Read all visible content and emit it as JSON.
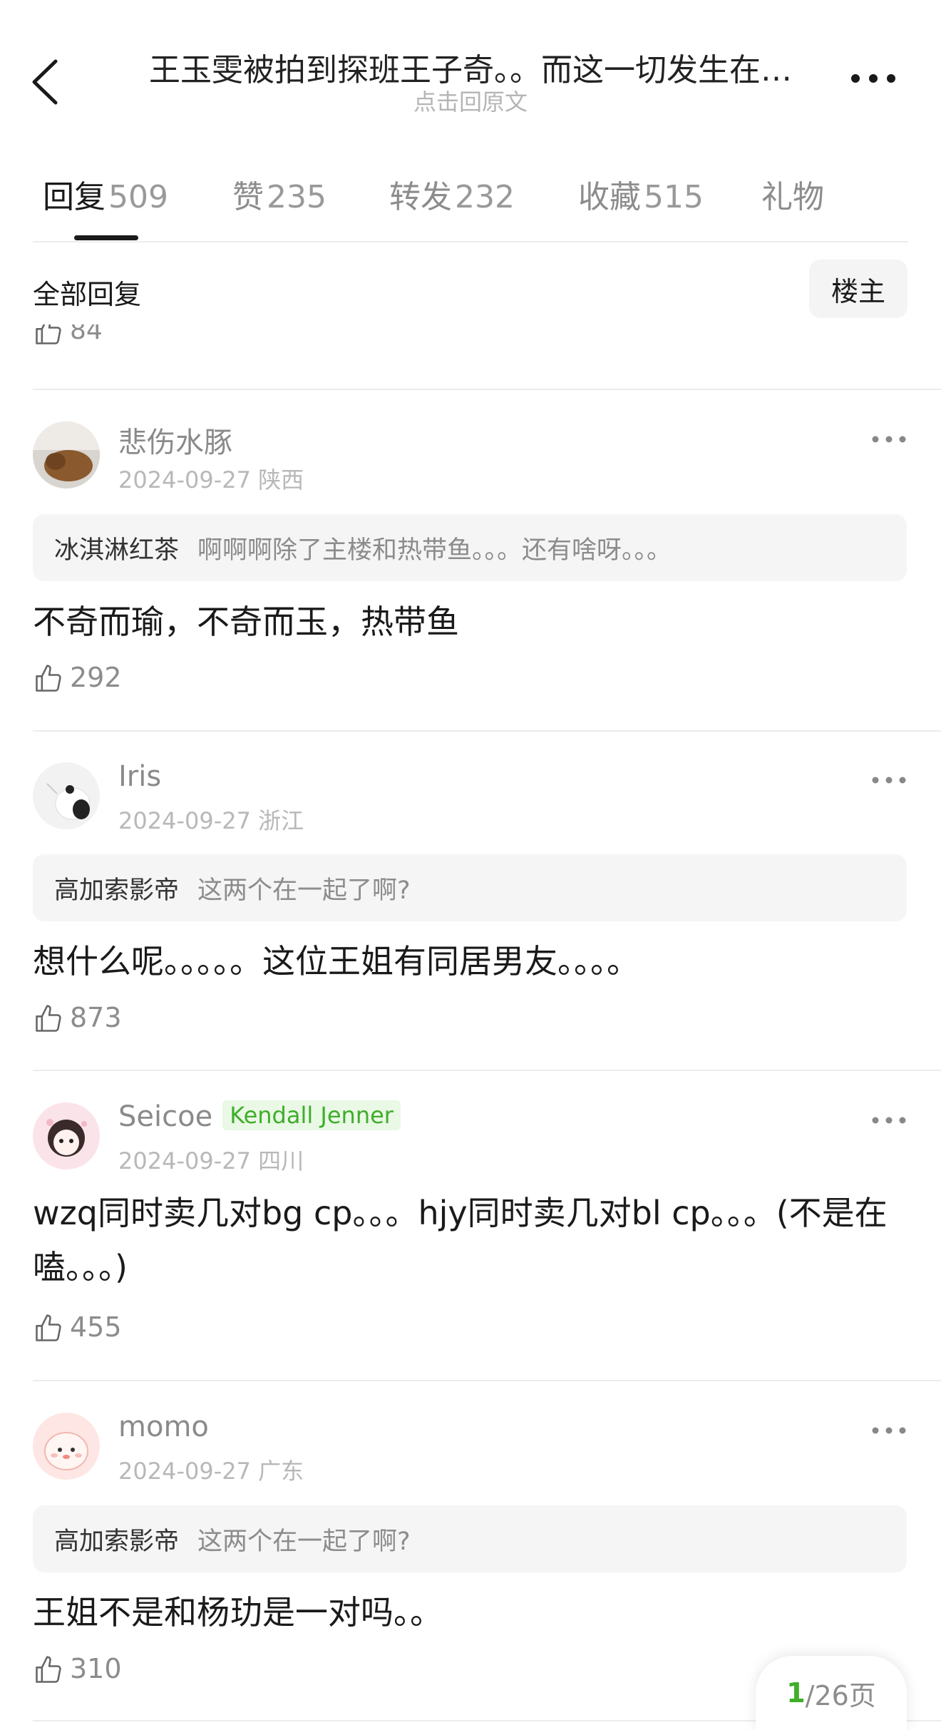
{
  "header": {
    "title": "王玉雯被拍到探班王子奇。。而这一切发生在…",
    "subtitle": "点击回原文"
  },
  "tabs": [
    {
      "label": "回复",
      "count": "509"
    },
    {
      "label": "赞",
      "count": "235"
    },
    {
      "label": "转发",
      "count": "232"
    },
    {
      "label": "收藏",
      "count": "515"
    },
    {
      "label": "礼物",
      "count": ""
    }
  ],
  "filter": {
    "label": "全部回复",
    "button": "楼主"
  },
  "partial_likes": "84",
  "comments": [
    {
      "user": "悲伤水豚",
      "date": "2024-09-27 陕西",
      "quote_name": "冰淇淋红茶",
      "quote_text": "啊啊啊除了主楼和热带鱼。。。还有啥呀。。。",
      "text": "不奇而瑜，不奇而玉，热带鱼",
      "likes": "292"
    },
    {
      "user": "Iris",
      "date": "2024-09-27 浙江",
      "quote_name": "高加索影帝",
      "quote_text": "这两个在一起了啊?",
      "text": "想什么呢。。。。。这位王姐有同居男友。。。。",
      "likes": "873"
    },
    {
      "user": "Seicoe",
      "badge": "Kendall Jenner",
      "date": "2024-09-27 四川",
      "text": "wzq同时卖几对bg cp。。。hjy同时卖几对bl cp。。。(不是在嗑。。。)",
      "likes": "455"
    },
    {
      "user": "momo",
      "date": "2024-09-27 广东",
      "quote_name": "高加索影帝",
      "quote_text": "这两个在一起了啊?",
      "text": "王姐不是和杨玏是一对吗。。",
      "likes": "310"
    }
  ],
  "pager": {
    "current": "1",
    "total": "/26页"
  },
  "colors": {
    "accent_green": "#3fae2a",
    "badge_bg": "#eaf8e6"
  }
}
